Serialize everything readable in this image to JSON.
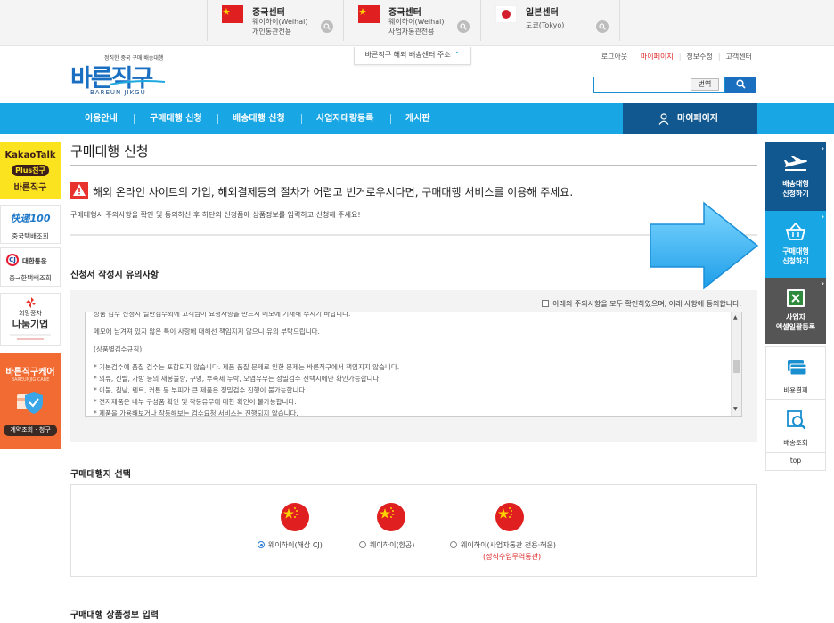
{
  "topbar": {
    "centers": [
      {
        "title": "중국센터",
        "line1": "웨이하이(Weihai)",
        "line2": "개인통관전용"
      },
      {
        "title": "중국센터",
        "line1": "웨이하이(Weihai)",
        "line2": "사업자통관전용"
      },
      {
        "title": "일본센터",
        "line1": "도쿄(Tokyo)",
        "line2": ""
      }
    ]
  },
  "header": {
    "address_tab": "바른직구 해외 배송센터 주소",
    "logo_tagline": "정직한 중국 구매 배송대행",
    "logo_text": "바른직구",
    "logo_sub": "BAREUN JIKGU",
    "util": [
      "로그아웃",
      "마이페이지",
      "정보수정",
      "고객센터"
    ],
    "translate_label": "번역",
    "search_value": ""
  },
  "nav": {
    "items": [
      "이용안내",
      "구매대행 신청",
      "배송대행 신청",
      "사업자대량등록",
      "게시판"
    ],
    "mypage": "마이페이지"
  },
  "left_banners": {
    "kakao": {
      "l1": "KakaoTalk",
      "l2": "Plus친구",
      "l3": "바른직구"
    },
    "kuaidi": {
      "l1": "快递100",
      "l2": "중국택배조회"
    },
    "cj": {
      "l1": "대한통운",
      "l2": "중→한택배조회"
    },
    "hope": {
      "l1": "희망풍차",
      "l2": "나눔기업"
    },
    "care": {
      "l1": "바른직구케어",
      "l2": "BAREUNJIG CARE",
      "l3": "계약조회 · 청구"
    }
  },
  "main": {
    "page_title": "구매대행 신청",
    "warning": "해외 온라인 사이트의 가입, 해외결제등의 절차가 어렵고 번거로우시다면, 구매대행 서비스를 이용해 주세요.",
    "subnote": "구매대행시 주의사항을 확인 및 동의하신 후 하단의 신청폼에 상품정보를 입력하고 신청해 주세요!",
    "notice_title": "신청서 작성시 유의사항",
    "agree_label": "아래의 주의사항을 모두 확인하였으며, 아래 사항에 동의합니다.",
    "notice_lines": [
      "상품 검수 신청시 일반검수외에 고객님이 요청사항을 반드시 메모에 기재해 주시기 바랍니다.",
      "",
      "메모에 남겨져 있지 않은 특이 사항에 대해선 책임지지 않으니 유의 부탁드립니다.",
      "",
      "(상품별검수규칙)",
      "",
      "* 기본검수에 품질 검수는 포함되지 않습니다. 제품 품질 문제로 인한 문제는 바른직구에서 책임지지 않습니다.",
      "* 의류, 신발, 가방 등의 재봉불량, 구멍, 부속제 누락, 오염유무는 정밀검수 선택시에만 확인가능합니다.",
      "* 이불, 침낭, 텐트, 커튼 등 부피가 큰 제품은 정밀검수 진행이 불가능합니다.",
      "* 전자제품은 내부 구성품 확인 및 작동유무에 대한 확인이 불가능합니다.",
      "* 제품을 가용해보거나 작동해보는 검수요청 서비스는 진행되지 않습니다."
    ],
    "agent_title": "구매대행지 선택",
    "agents": [
      {
        "label": "웨이하이(해상 CJ)",
        "note": "",
        "selected": true
      },
      {
        "label": "웨이하이(항공)",
        "note": "",
        "selected": false
      },
      {
        "label": "웨이하이(사업자통관 전용·해운)",
        "note": "(정식수입무역통관)",
        "selected": false
      }
    ],
    "product_title": "구매대행 상품정보 입력"
  },
  "quickmenu": {
    "shipping": "배송대행\n신청하기",
    "purchase": "구매대행\n신청하기",
    "excel": "사업자\n엑셀일괄등록",
    "payment": "비용결제",
    "tracking": "배송조회",
    "top": "top"
  },
  "colors": {
    "nav": "#18a6e4",
    "mypage": "#10588f",
    "purchase_active": "#18a6e4",
    "shipping": "#10588f",
    "excel": "#555555"
  }
}
